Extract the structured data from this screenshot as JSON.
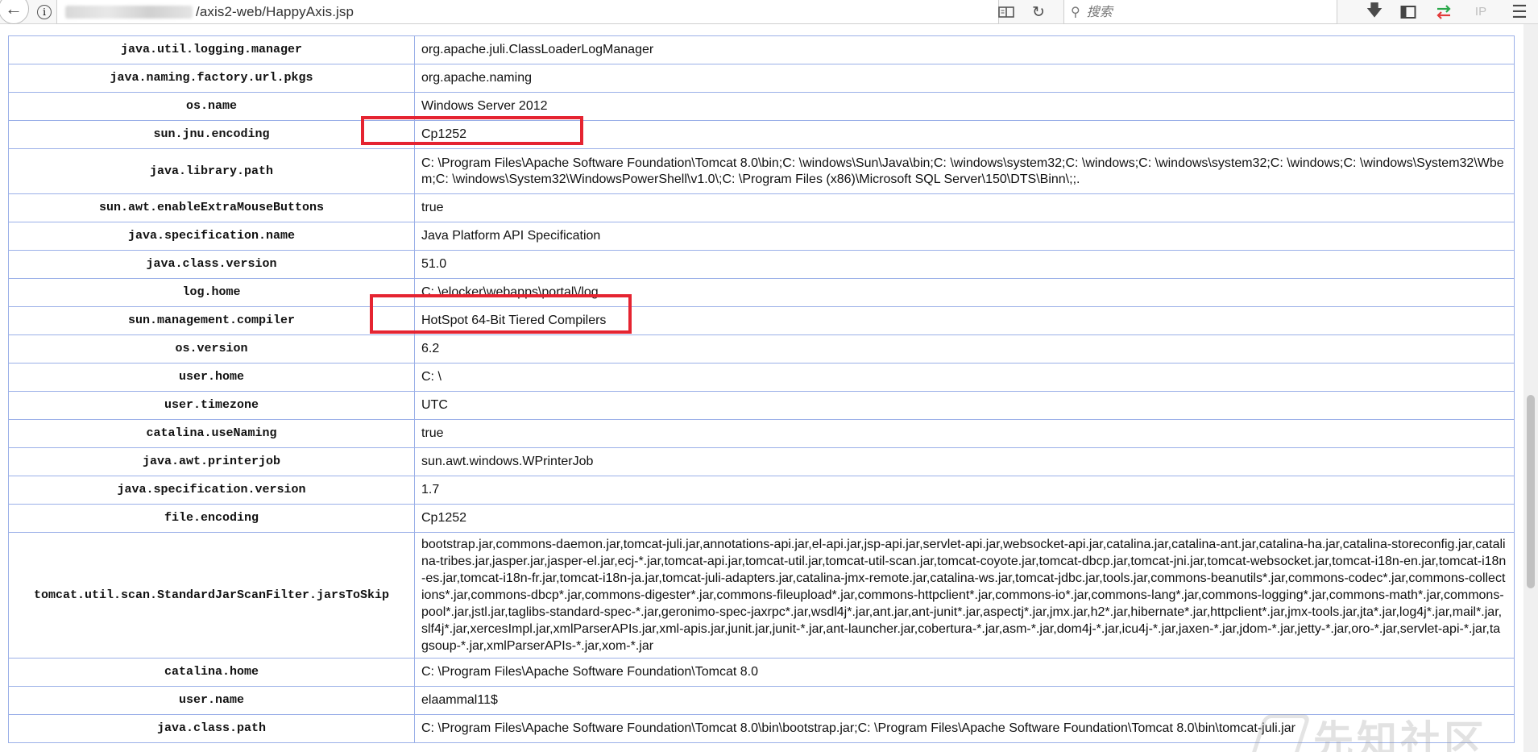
{
  "browser": {
    "url_path": "/axis2-web/HappyAxis.jsp",
    "search_placeholder": "搜索",
    "ip_label": "IP",
    "icons": {
      "back": "back-arrow-icon",
      "info": "info-icon",
      "reader": "reader-view-icon",
      "reload": "reload-icon",
      "search": "search-icon",
      "download": "download-icon",
      "library": "library-icon",
      "sync": "sync-arrows-icon",
      "menu": "hamburger-menu-icon"
    }
  },
  "properties": [
    {
      "key": "java.util.logging.manager",
      "value": "org.apache.juli.ClassLoaderLogManager"
    },
    {
      "key": "java.naming.factory.url.pkgs",
      "value": "org.apache.naming"
    },
    {
      "key": "os.name",
      "value": "Windows Server 2012"
    },
    {
      "key": "sun.jnu.encoding",
      "value": "Cp1252"
    },
    {
      "key": "java.library.path",
      "value": "C: \\Program Files\\Apache Software Foundation\\Tomcat 8.0\\bin;C: \\windows\\Sun\\Java\\bin;C: \\windows\\system32;C: \\windows;C: \\windows\\system32;C: \\windows;C: \\windows\\System32\\Wbem;C: \\windows\\System32\\WindowsPowerShell\\v1.0\\;C: \\Program Files (x86)\\Microsoft SQL Server\\150\\DTS\\Binn\\;;."
    },
    {
      "key": "sun.awt.enableExtraMouseButtons",
      "value": "true"
    },
    {
      "key": "java.specification.name",
      "value": "Java Platform API Specification"
    },
    {
      "key": "java.class.version",
      "value": "51.0"
    },
    {
      "key": "log.home",
      "value": "C: \\elocker\\webapps\\portal\\/log"
    },
    {
      "key": "sun.management.compiler",
      "value": "HotSpot 64-Bit Tiered Compilers"
    },
    {
      "key": "os.version",
      "value": "6.2"
    },
    {
      "key": "user.home",
      "value": "C: \\"
    },
    {
      "key": "user.timezone",
      "value": "UTC"
    },
    {
      "key": "catalina.useNaming",
      "value": "true"
    },
    {
      "key": "java.awt.printerjob",
      "value": "sun.awt.windows.WPrinterJob"
    },
    {
      "key": "java.specification.version",
      "value": "1.7"
    },
    {
      "key": "file.encoding",
      "value": "Cp1252"
    },
    {
      "key": "tomcat.util.scan.StandardJarScanFilter.jarsToSkip",
      "value": "bootstrap.jar,commons-daemon.jar,tomcat-juli.jar,annotations-api.jar,el-api.jar,jsp-api.jar,servlet-api.jar,websocket-api.jar,catalina.jar,catalina-ant.jar,catalina-ha.jar,catalina-storeconfig.jar,catalina-tribes.jar,jasper.jar,jasper-el.jar,ecj-*.jar,tomcat-api.jar,tomcat-util.jar,tomcat-util-scan.jar,tomcat-coyote.jar,tomcat-dbcp.jar,tomcat-jni.jar,tomcat-websocket.jar,tomcat-i18n-en.jar,tomcat-i18n-es.jar,tomcat-i18n-fr.jar,tomcat-i18n-ja.jar,tomcat-juli-adapters.jar,catalina-jmx-remote.jar,catalina-ws.jar,tomcat-jdbc.jar,tools.jar,commons-beanutils*.jar,commons-codec*.jar,commons-collections*.jar,commons-dbcp*.jar,commons-digester*.jar,commons-fileupload*.jar,commons-httpclient*.jar,commons-io*.jar,commons-lang*.jar,commons-logging*.jar,commons-math*.jar,commons-pool*.jar,jstl.jar,taglibs-standard-spec-*.jar,geronimo-spec-jaxrpc*.jar,wsdl4j*.jar,ant.jar,ant-junit*.jar,aspectj*.jar,jmx.jar,h2*.jar,hibernate*.jar,httpclient*.jar,jmx-tools.jar,jta*.jar,log4j*.jar,mail*.jar,slf4j*.jar,xercesImpl.jar,xmlParserAPIs.jar,xml-apis.jar,junit.jar,junit-*.jar,ant-launcher.jar,cobertura-*.jar,asm-*.jar,dom4j-*.jar,icu4j-*.jar,jaxen-*.jar,jdom-*.jar,jetty-*.jar,oro-*.jar,servlet-api-*.jar,tagsoup-*.jar,xmlParserAPIs-*.jar,xom-*.jar"
    },
    {
      "key": "catalina.home",
      "value": "C: \\Program Files\\Apache Software Foundation\\Tomcat 8.0"
    },
    {
      "key": "user.name",
      "value": "elaammal11$"
    },
    {
      "key": "java.class.path",
      "value": "C: \\Program Files\\Apache Software Foundation\\Tomcat 8.0\\bin\\bootstrap.jar;C: \\Program Files\\Apache Software Foundation\\Tomcat 8.0\\bin\\tomcat-juli.jar"
    }
  ],
  "watermark": {
    "text": "先知社区"
  },
  "colors": {
    "highlight": "#e52431",
    "table_border": "#9bb0e8"
  }
}
